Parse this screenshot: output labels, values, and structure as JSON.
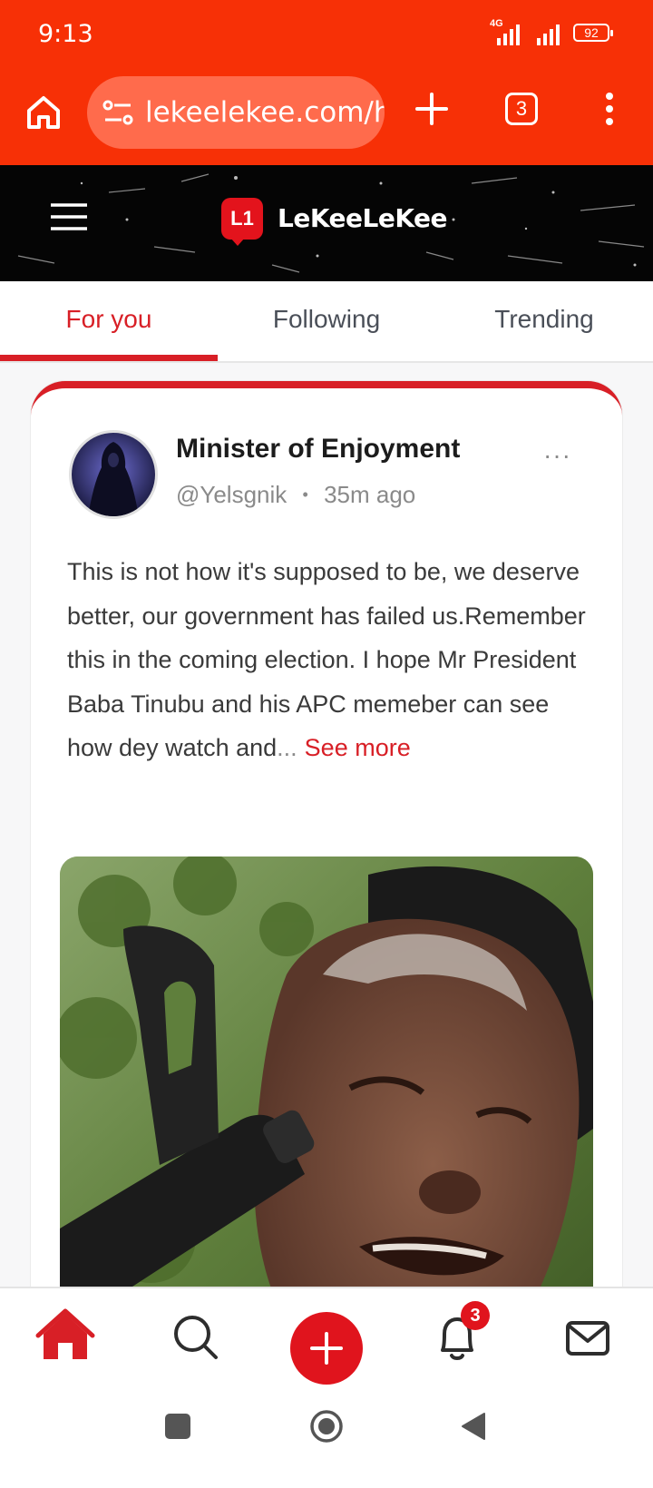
{
  "status_bar": {
    "time": "9:13",
    "network": "4G",
    "battery": "92"
  },
  "browser": {
    "url": "lekeelekee.com/h",
    "tab_count": "3"
  },
  "app": {
    "logo_text": "LeKeeLeKee",
    "logo_mark": "L1"
  },
  "tabs": [
    {
      "label": "For you",
      "active": true
    },
    {
      "label": "Following",
      "active": false
    },
    {
      "label": "Trending",
      "active": false
    }
  ],
  "post": {
    "author_name": "Minister of Enjoyment",
    "handle": "@Yelsgnik",
    "separator": "•",
    "time_ago": "35m ago",
    "more": "···",
    "text": "This is not how it's supposed to be, we deserve better, our government has failed us.Remember this in the coming election. I hope Mr President Baba Tinubu and his APC memeber can see how dey watch and",
    "ellipsis": "...",
    "see_more": "See more"
  },
  "bottom_nav": {
    "items": [
      "home-icon",
      "search-icon",
      "add-icon",
      "bell-icon",
      "mail-icon"
    ],
    "notification_count": "3"
  },
  "colors": {
    "status_bar": "#f73006",
    "accent": "#d81f26",
    "app_header": "#050505"
  }
}
